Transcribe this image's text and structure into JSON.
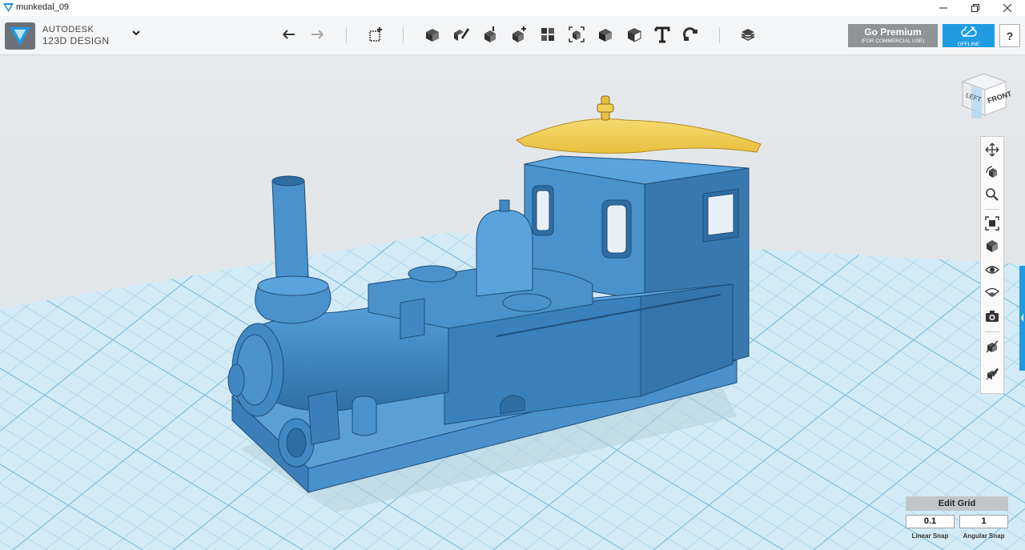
{
  "window": {
    "title": "munkedal_09"
  },
  "brand": {
    "line1": "AUTODESK",
    "line2": "123D",
    "line2b": " DESIGN"
  },
  "toolbar": {
    "undo": "undo-icon",
    "redo": "redo-icon",
    "tools": [
      "primitives-icon",
      "sketch-icon",
      "construct-icon",
      "modify-icon",
      "pattern-icon",
      "grouping-icon",
      "combine-icon",
      "measure-icon",
      "text-icon",
      "snap-icon",
      "materials-icon"
    ]
  },
  "premium": {
    "line1": "Go Premium",
    "line2": "(FOR COMMERCIAL USE)"
  },
  "offline": {
    "label": "OFFLINE"
  },
  "help": {
    "label": "?"
  },
  "viewcube": {
    "left": "LEFT",
    "front": "FRONT"
  },
  "grid": {
    "edit_label": "Edit Grid",
    "linear_snap": "0.1",
    "angular_snap": "1",
    "linear_label": "Linear Snap",
    "angular_label": "Angular Snap"
  },
  "colors": {
    "accent": "#1f9be3",
    "model": "#3f88c4",
    "roof": "#f2cf57",
    "grid_bg": "#e3e6e8"
  }
}
